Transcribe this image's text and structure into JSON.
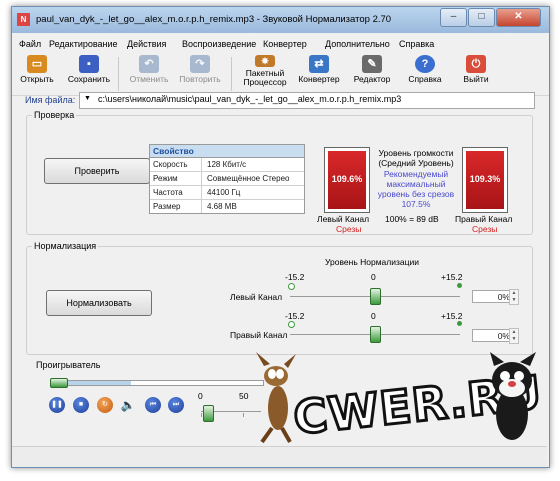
{
  "window": {
    "title": "paul_van_dyk_-_let_go__alex_m.o.r.p.h_remix.mp3 - Звуковой Нормализатор 2.70",
    "app_icon": "N",
    "controls": {
      "minimize": "–",
      "maximize": "□",
      "close": "✕"
    }
  },
  "menu": [
    "Файл",
    "Редактирование",
    "Действия",
    "Воспроизведение",
    "Конвертер",
    "Дополнительно",
    "Справка"
  ],
  "toolbar": [
    {
      "label": "Открыть",
      "icon": "open-folder-icon",
      "color": "#d98a1f",
      "enabled": true
    },
    {
      "label": "Сохранить",
      "icon": "save-disk-icon",
      "color": "#3b5fc2",
      "enabled": true
    },
    {
      "label": "Отменить",
      "icon": "undo-icon",
      "color": "#6c8bb5",
      "enabled": false
    },
    {
      "label": "Повторить",
      "icon": "redo-icon",
      "color": "#6c8bb5",
      "enabled": false
    },
    {
      "label": "Пакетный Процессор",
      "icon": "batch-processor-icon",
      "color": "#c07a2a",
      "enabled": true
    },
    {
      "label": "Конвертер",
      "icon": "converter-icon",
      "color": "#3a76c6",
      "enabled": true
    },
    {
      "label": "Редактор",
      "icon": "editor-icon",
      "color": "#6a6a6a",
      "enabled": true
    },
    {
      "label": "Справка",
      "icon": "help-icon",
      "color": "#3a6fd0",
      "enabled": true
    },
    {
      "label": "Выйти",
      "icon": "exit-icon",
      "color": "#d94d3a",
      "enabled": true
    }
  ],
  "file": {
    "label": "Имя файла:",
    "value": "c:\\users\\николай\\music\\paul_van_dyk_-_let_go__alex_m.o.r.p.h_remix.mp3"
  },
  "check": {
    "title": "Проверка",
    "button": "Проверить",
    "properties_header": "Свойство",
    "properties": [
      {
        "key": "Скорость",
        "value": "128 Кбит/с"
      },
      {
        "key": "Режим",
        "value": "Совмещённое Стерео"
      },
      {
        "key": "Частота",
        "value": "44100 Гц"
      },
      {
        "key": "Размер",
        "value": "4.68 MB"
      }
    ],
    "left_meter": {
      "value_text": "109.6%",
      "level": 1.0,
      "label": "Левый Канал",
      "status": "Срезы"
    },
    "right_meter": {
      "value_text": "109.3%",
      "level": 1.0,
      "label": "Правый Канал",
      "status": "Срезы"
    },
    "loudness_title": "Уровень громкости\n(Средний Уровень)",
    "recommended_text": "Рекомендуемый\nмаксимальный\nуровень без срезов\n107.5%",
    "current_level": "100% = 89 dB"
  },
  "normalize": {
    "title": "Нормализация",
    "button": "Нормализовать",
    "level_title": "Уровень Нормализации",
    "left": {
      "label": "Левый Канал",
      "min": "-15.2",
      "mid": "0",
      "max": "+15.2",
      "value": 0,
      "percent": "0%"
    },
    "right": {
      "label": "Правый Канал",
      "min": "-15.2",
      "mid": "0",
      "max": "+15.2",
      "value": 0,
      "percent": "0%"
    }
  },
  "player": {
    "title": "Проигрыватель",
    "controls": [
      {
        "name": "pause-icon",
        "glyph": "❚❚"
      },
      {
        "name": "stop-icon",
        "glyph": "■"
      },
      {
        "name": "repeat-icon",
        "glyph": "↻"
      },
      {
        "name": "volume-icon",
        "glyph": "🔈"
      },
      {
        "name": "previous-icon",
        "glyph": "⏮"
      },
      {
        "name": "next-icon",
        "glyph": "⏭"
      }
    ],
    "volume_scale": [
      "0",
      "50"
    ],
    "volume_value": 0
  },
  "watermark": "CWER.RU",
  "colors": {
    "meter_red": "#c81e20",
    "link_blue": "#1f3f8f",
    "accent_green": "#3c9a3c"
  }
}
